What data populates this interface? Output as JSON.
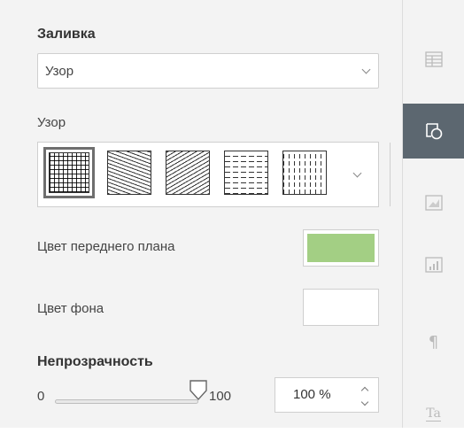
{
  "fill": {
    "heading": "Заливка",
    "type_value": "Узор"
  },
  "pattern": {
    "label": "Узор",
    "swatches": [
      {
        "name": "grid"
      },
      {
        "name": "diagonal-down"
      },
      {
        "name": "diagonal-up"
      },
      {
        "name": "dashed-horizontal"
      },
      {
        "name": "dashed-vertical"
      }
    ]
  },
  "foreground": {
    "label": "Цвет переднего плана",
    "color": "#a3cf84"
  },
  "background": {
    "label": "Цвет фона",
    "color": "#ffffff"
  },
  "opacity": {
    "heading": "Непрозрачность",
    "min_label": "0",
    "max_label": "100",
    "value": 100,
    "value_text": "100 %"
  },
  "sidebar": {
    "items": [
      {
        "icon": "table-icon",
        "active": false
      },
      {
        "icon": "shape-icon",
        "active": true
      },
      {
        "icon": "image-icon",
        "active": false
      },
      {
        "icon": "chart-icon",
        "active": false
      },
      {
        "icon": "paragraph-icon",
        "active": false
      },
      {
        "icon": "text-art-icon",
        "active": false,
        "text": "Ta"
      }
    ]
  }
}
